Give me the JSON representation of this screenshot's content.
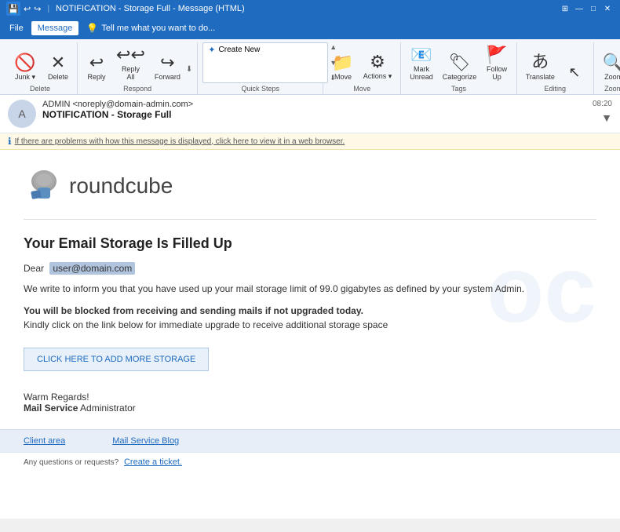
{
  "titlebar": {
    "title": "NOTIFICATION - Storage Full - Message (HTML)",
    "save_icon": "💾",
    "undo_icon": "↩",
    "redo_icon": "↪",
    "controls": [
      "—",
      "□",
      "✕"
    ]
  },
  "menubar": {
    "items": [
      "File",
      "Message"
    ],
    "active": "Message",
    "search_placeholder": "Tell me what you want to do...",
    "search_icon": "🔍"
  },
  "ribbon": {
    "groups": [
      {
        "name": "delete",
        "label": "Delete",
        "buttons": [
          {
            "id": "junk",
            "icon": "🚫",
            "label": "Junk ▾"
          },
          {
            "id": "delete",
            "icon": "✕",
            "label": "Delete"
          }
        ]
      },
      {
        "name": "respond",
        "label": "Respond",
        "buttons": [
          {
            "id": "reply",
            "icon": "↩",
            "label": "Reply"
          },
          {
            "id": "reply-all",
            "icon": "↩↩",
            "label": "Reply\nAll"
          },
          {
            "id": "forward",
            "icon": "↪",
            "label": "Forward"
          },
          {
            "id": "more",
            "icon": "⬇",
            "label": ""
          }
        ]
      },
      {
        "name": "quick-steps",
        "label": "Quick Steps",
        "items": [
          {
            "label": "Create New"
          }
        ]
      },
      {
        "name": "move",
        "label": "Move",
        "buttons": [
          {
            "id": "move-btn",
            "icon": "📁",
            "label": "Move"
          },
          {
            "id": "actions-btn",
            "icon": "⚙",
            "label": "Actions ▾"
          }
        ]
      },
      {
        "name": "tags",
        "label": "Tags",
        "buttons": [
          {
            "id": "mark-unread",
            "icon": "📧",
            "label": "Mark\nUnread"
          },
          {
            "id": "categorize",
            "icon": "🏷",
            "label": "Categorize"
          },
          {
            "id": "follow-up",
            "icon": "🚩",
            "label": "Follow\nUp"
          }
        ]
      },
      {
        "name": "editing",
        "label": "Editing",
        "buttons": [
          {
            "id": "translate",
            "icon": "あ",
            "label": "Translate"
          }
        ]
      },
      {
        "name": "zoom",
        "label": "Zoom",
        "buttons": [
          {
            "id": "zoom-btn",
            "icon": "🔍",
            "label": "Zoom"
          }
        ]
      }
    ]
  },
  "email": {
    "from": "ADMIN <noreply@domain-admin.com>",
    "subject": "NOTIFICATION - Storage Full",
    "time": "08:20",
    "avatar_initial": "A",
    "infobar": "If there are problems with how this message is displayed, click here to view it in a web browser.",
    "logo_text": "roundcube",
    "heading": "Your Email Storage Is Filled Up",
    "dear_label": "Dear",
    "dear_name": "user@domain.com",
    "para1": "We write to inform you that you have used up your mail storage limit of 99.0 gigabytes as defined by your system Admin.",
    "para2_bold": "You will be blocked from receiving and sending mails if not upgraded today.",
    "para2_normal": "Kindly click on the link below for immediate upgrade to receive additional storage space",
    "cta": "CLICK HERE TO ADD MORE STORAGE",
    "regards": "Warm Regards!",
    "sig_bold": "Mail Service",
    "sig_normal": " Administrator",
    "footer_links": [
      "Client area",
      "Mail Service Blog"
    ],
    "footer_note_prefix": "Any questions or requests?",
    "footer_note_link": "Create a ticket."
  }
}
